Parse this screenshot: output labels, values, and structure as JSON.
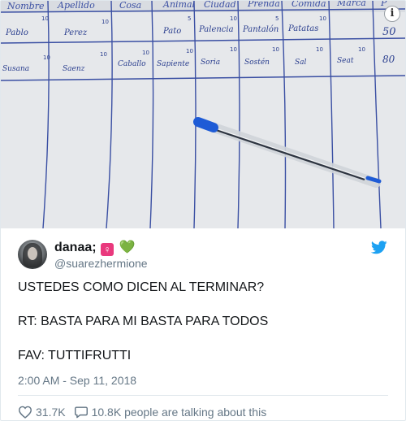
{
  "media": {
    "headers": [
      "Nombre",
      "Apellido",
      "Cosa",
      "Animal",
      "Ciudad",
      "Prenda",
      "Comida",
      "Marca",
      "P"
    ],
    "row1": {
      "entries": [
        "Pablo",
        "Perez",
        "Pato",
        "Palencia",
        "Pantalón",
        "Patatas",
        "50"
      ],
      "scores": [
        "10",
        "10",
        "5",
        "10",
        "5",
        "10"
      ]
    },
    "row2": {
      "entries": [
        "Susana",
        "Saenz",
        "Caballo",
        "Sapiente",
        "Soria",
        "Sostén",
        "Sal",
        "Seat",
        "80"
      ],
      "scores": [
        "10",
        "10",
        "10",
        "10",
        "10",
        "10",
        "10",
        "10"
      ]
    },
    "info_icon": "i"
  },
  "tweet": {
    "display_name": "danaa;",
    "emoji_female": "♀",
    "emoji_heart": "💚",
    "handle": "@suarezhermione",
    "lines": [
      "USTEDES COMO DICEN AL TERMINAR?",
      "RT: BASTA PARA MI BASTA PARA TODOS",
      "FAV: TUTTIFRUTTI"
    ],
    "timestamp": "2:00 AM - Sep 11, 2018",
    "likes": "31.7K",
    "conversation": "10.8K people are talking about this"
  },
  "colors": {
    "ink": "#2b3f8f",
    "twitter_blue": "#1da1f2",
    "muted": "#657786"
  },
  "icons": {
    "heart": "heart-icon",
    "reply": "speech-bubble-icon",
    "bird": "twitter-bird-icon",
    "info": "info-icon"
  }
}
